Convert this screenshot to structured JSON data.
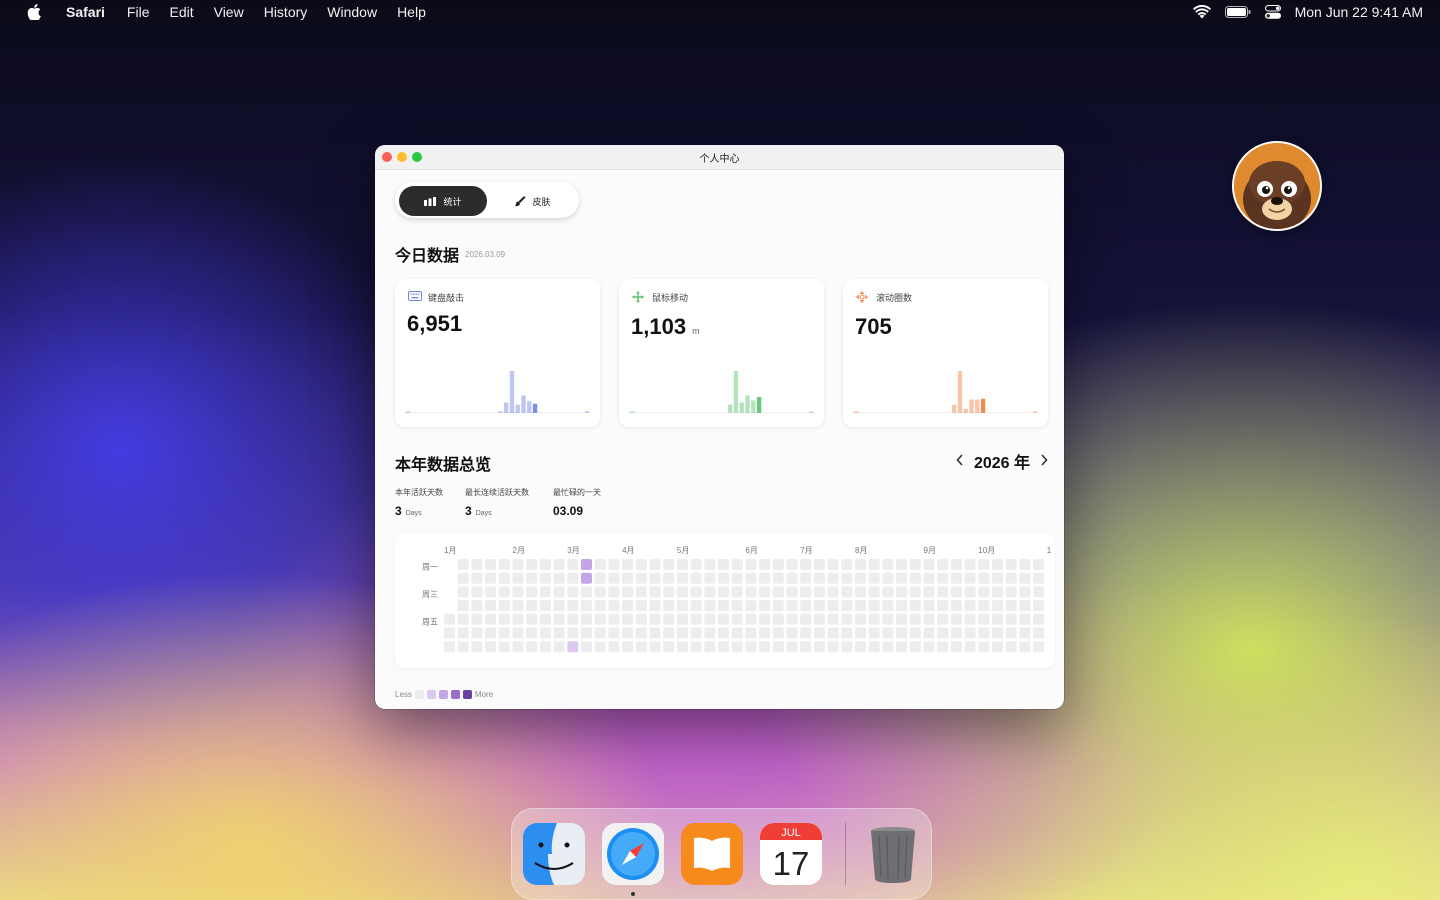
{
  "menubar": {
    "app_name": "Safari",
    "menus": [
      "File",
      "Edit",
      "View",
      "History",
      "Window",
      "Help"
    ],
    "clock": "Mon Jun 22  9:41 AM"
  },
  "window": {
    "title": "个人中心",
    "tabs": [
      {
        "label": "统计",
        "icon": "bar-chart-icon",
        "active": true
      },
      {
        "label": "皮肤",
        "icon": "brush-icon",
        "active": false
      }
    ],
    "today": {
      "title": "今日数据",
      "date": "2026.03.09",
      "cards": [
        {
          "label": "键盘敲击",
          "icon": "keyboard-icon",
          "value": "6,951",
          "unit": "",
          "color": "#7b8fe6",
          "bars": [
            0.03,
            0,
            0,
            0,
            0,
            0,
            0,
            0,
            0,
            0,
            0,
            0,
            0,
            0,
            0,
            0,
            0.02,
            0.25,
            1.0,
            0.2,
            0.42,
            0.28,
            0.22,
            0,
            0,
            0,
            0,
            0,
            0,
            0,
            0,
            0.01
          ]
        },
        {
          "label": "鼠标移动",
          "icon": "move-arrows-icon",
          "value": "1,103",
          "unit": "m",
          "color": "#68c77a",
          "bars": [
            0.02,
            0,
            0,
            0,
            0,
            0,
            0,
            0,
            0,
            0,
            0,
            0,
            0,
            0,
            0,
            0,
            0,
            0.2,
            1.0,
            0.25,
            0.42,
            0.3,
            0.38,
            0,
            0,
            0,
            0,
            0,
            0,
            0,
            0,
            0.01
          ]
        },
        {
          "label": "滚动圈数",
          "icon": "scroll-icon",
          "value": "705",
          "unit": "",
          "color": "#ef8c55",
          "bars": [
            0.02,
            0,
            0,
            0,
            0,
            0,
            0,
            0,
            0,
            0,
            0,
            0,
            0,
            0,
            0,
            0,
            0,
            0.2,
            1.0,
            0.1,
            0.32,
            0.32,
            0.34,
            0,
            0,
            0,
            0,
            0,
            0,
            0,
            0,
            0.01
          ]
        }
      ]
    },
    "overview": {
      "title": "本年数据总览",
      "year": "2026 年",
      "stats": [
        {
          "label": "本年活跃天数",
          "value": "3",
          "unit": "Days"
        },
        {
          "label": "最长连续活跃天数",
          "value": "3",
          "unit": "Days"
        },
        {
          "label": "最忙碌的一天",
          "value": "03.09",
          "unit": ""
        }
      ],
      "months": [
        "1月",
        "2月",
        "3月",
        "4月",
        "5月",
        "6月",
        "7月",
        "8月",
        "9月",
        "10月",
        "1"
      ],
      "weekday_labels": [
        "周一",
        "周三",
        "周五"
      ],
      "active_days": [
        {
          "date": "2026-03-07",
          "level": 1
        },
        {
          "date": "2026-03-08",
          "level": 2
        },
        {
          "date": "2026-03-09",
          "level": 2
        }
      ],
      "legend": {
        "less": "Less",
        "more": "More",
        "colors": [
          "#ededf0",
          "#dcc8ee",
          "#c4a6e4",
          "#9b6fc9",
          "#6d3fa3"
        ]
      }
    }
  },
  "dock": {
    "apps": [
      {
        "name": "Finder",
        "icon": "finder-icon"
      },
      {
        "name": "Safari",
        "icon": "safari-icon"
      },
      {
        "name": "Books",
        "icon": "books-icon"
      },
      {
        "name": "Calendar",
        "icon": "calendar-icon",
        "month": "JUL",
        "day": "17"
      },
      {
        "name": "Trash",
        "icon": "trash-icon"
      }
    ]
  }
}
